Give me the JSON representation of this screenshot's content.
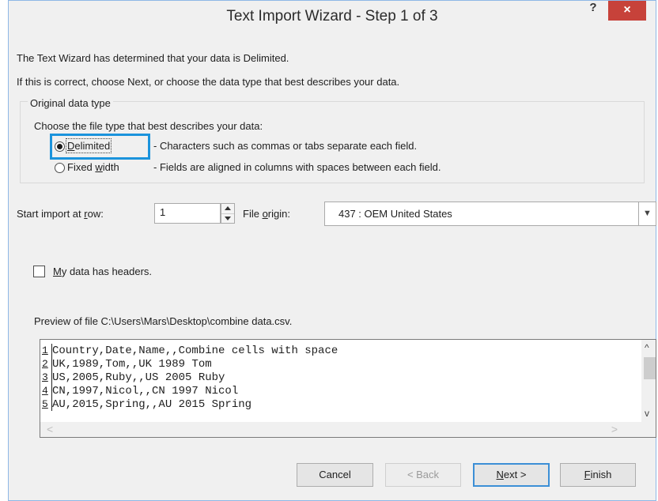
{
  "window": {
    "title": "Text Import Wizard - Step 1 of 3",
    "help_label": "?",
    "close_label": "×"
  },
  "intro": {
    "line1": "The Text Wizard has determined that your data is Delimited.",
    "line2": "If this is correct, choose Next, or choose the data type that best describes your data."
  },
  "original_data_type": {
    "group_label": "Original data type",
    "prompt": "Choose the file type that best describes your data:",
    "options": [
      {
        "pre": "",
        "mnemonic": "D",
        "post": "elimited",
        "description": "- Characters such as commas or tabs separate each field.",
        "selected": true
      },
      {
        "pre": "Fixed ",
        "mnemonic": "w",
        "post": "idth",
        "description": "- Fields are aligned in columns with spaces between each field.",
        "selected": false
      }
    ]
  },
  "import_row": {
    "label_pre": "Start import at ",
    "label_mnemonic": "r",
    "label_post": "ow:",
    "value": "1"
  },
  "file_origin": {
    "label_pre": "File ",
    "label_mnemonic": "o",
    "label_post": "rigin:",
    "value": "437 : OEM United States",
    "arrow": "▼"
  },
  "headers_checkbox": {
    "label_mnemonic": "M",
    "label_post": "y data has headers.",
    "checked": false
  },
  "preview": {
    "label": "Preview of file C:\\Users\\Mars\\Desktop\\combine data.csv.",
    "rows": [
      {
        "num": "1",
        "text": "Country,Date,Name,,Combine cells with space"
      },
      {
        "num": "2",
        "text": "UK,1989,Tom,,UK 1989 Tom"
      },
      {
        "num": "3",
        "text": "US,2005,Ruby,,US 2005 Ruby"
      },
      {
        "num": "4",
        "text": "CN,1997,Nicol,,CN 1997 Nicol"
      },
      {
        "num": "5",
        "text": "AU,2015,Spring,,AU 2015 Spring"
      }
    ],
    "scroll_up": "^",
    "scroll_down": "v",
    "scroll_left": "<",
    "scroll_right": ">"
  },
  "buttons": {
    "cancel": "Cancel",
    "back": "< Back",
    "next_mnemonic": "N",
    "next_post": "ext >",
    "finish_mnemonic": "F",
    "finish_post": "inish"
  },
  "colors": {
    "focus_highlight": "#1b93dc",
    "close_button": "#c7423a",
    "default_button_border": "#3c8fd6"
  }
}
